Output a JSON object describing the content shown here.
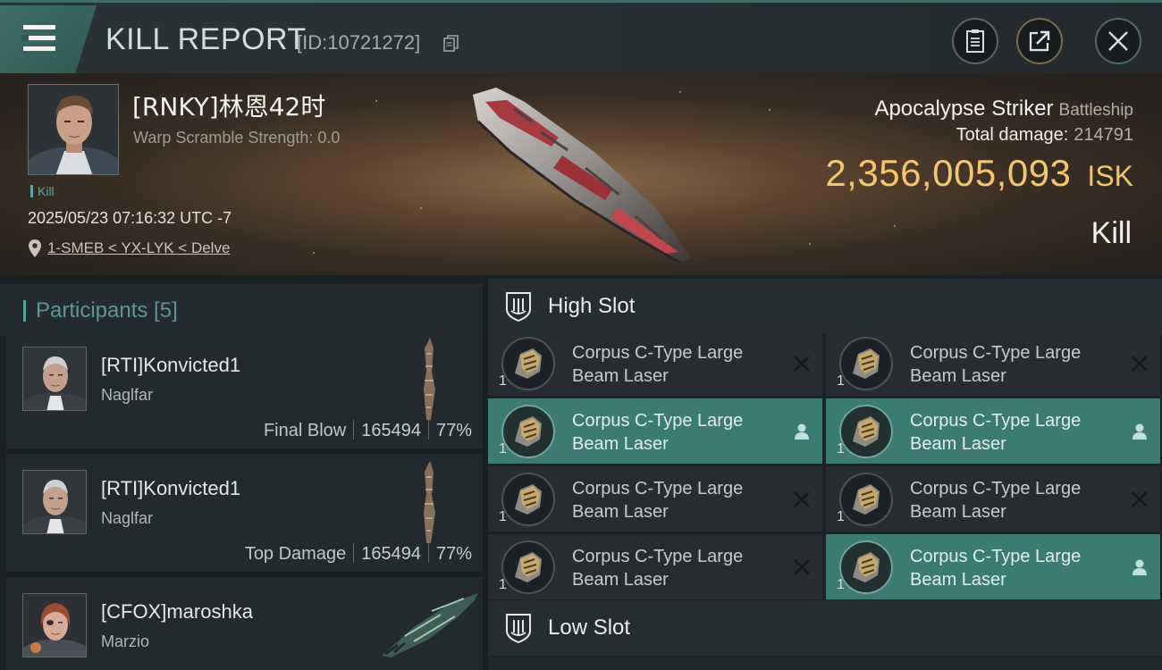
{
  "header": {
    "title": "KILL REPORT",
    "report_id": "[ID:10721272]",
    "icons": {
      "menu": "hamburger-menu-icon",
      "copy": "copy-icon",
      "clipboard": "clipboard-icon",
      "share": "share-icon",
      "close": "close-icon"
    }
  },
  "victim": {
    "name": "[RNKY]林恩42时",
    "warp_scramble": "Warp Scramble Strength: 0.0",
    "tag": "Kill",
    "datetime": "2025/05/23 07:16:32 UTC -7",
    "location": "1-SMEB < YX-LYK < Delve",
    "ship_name": "Apocalypse Striker",
    "ship_class": "Battleship",
    "total_damage_label": "Total damage:",
    "total_damage": "214791",
    "isk_value": "2,356,005,093",
    "isk_unit": "ISK",
    "result": "Kill"
  },
  "participants": {
    "title": "Participants [5]",
    "rows": [
      {
        "name": "[RTI]Konvicted1",
        "ship": "Naglfar",
        "label": "Final Blow",
        "damage": "165494",
        "percent": "77%"
      },
      {
        "name": "[RTI]Konvicted1",
        "ship": "Naglfar",
        "label": "Top Damage",
        "damage": "165494",
        "percent": "77%"
      },
      {
        "name": "[CFOX]maroshka",
        "ship": "Marzio",
        "label": "",
        "damage": "",
        "percent": ""
      }
    ]
  },
  "slots": {
    "high_slot_title": "High Slot",
    "low_slot_title": "Low Slot",
    "high_modules": [
      {
        "name": "Corpus C-Type Large Beam Laser",
        "qty": "1",
        "status": "destroyed",
        "status_icon": "x-icon"
      },
      {
        "name": "Corpus C-Type Large Beam Laser",
        "qty": "1",
        "status": "destroyed",
        "status_icon": "x-icon"
      },
      {
        "name": "Corpus C-Type Large Beam Laser",
        "qty": "1",
        "status": "dropped",
        "status_icon": "person-icon"
      },
      {
        "name": "Corpus C-Type Large Beam Laser",
        "qty": "1",
        "status": "dropped",
        "status_icon": "person-icon"
      },
      {
        "name": "Corpus C-Type Large Beam Laser",
        "qty": "1",
        "status": "destroyed",
        "status_icon": "x-icon"
      },
      {
        "name": "Corpus C-Type Large Beam Laser",
        "qty": "1",
        "status": "destroyed",
        "status_icon": "x-icon"
      },
      {
        "name": "Corpus C-Type Large Beam Laser",
        "qty": "1",
        "status": "destroyed",
        "status_icon": "x-icon"
      },
      {
        "name": "Corpus C-Type Large Beam Laser",
        "qty": "1",
        "status": "dropped",
        "status_icon": "person-icon"
      }
    ]
  },
  "colors": {
    "accent_teal": "#3c7b73",
    "isk_gold": "#f3c56c",
    "panel_dark": "#1b2023"
  }
}
